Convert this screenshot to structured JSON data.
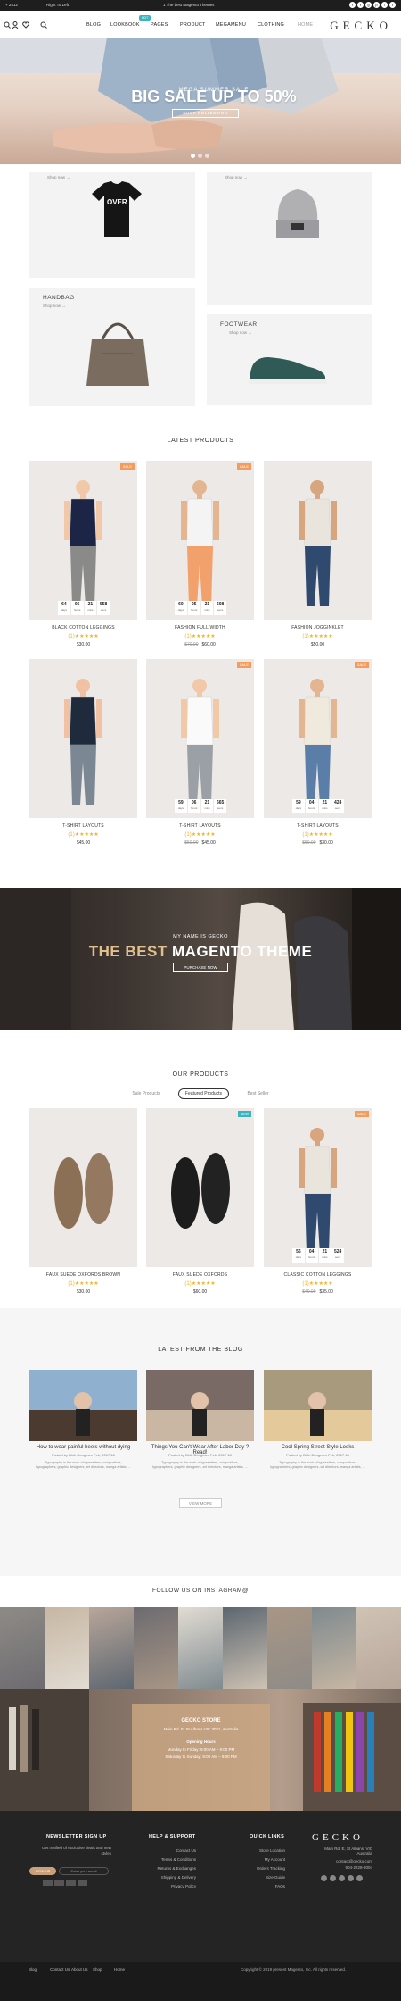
{
  "topbar": {
    "phone": "+ 2412",
    "account": "Right To Left",
    "promo": "1 The best Magento Themes",
    "social_icons": [
      "facebook-icon",
      "twitter-icon",
      "google-plus-icon",
      "pinterest-icon",
      "instagram-icon",
      "facebook-icon"
    ]
  },
  "header": {
    "logo": "GECKO",
    "nav": [
      "BLOG",
      "LOOKBOOK",
      "PAGES",
      "PRODUCT",
      "MEGAMENU",
      "CLOTHING",
      "HOME"
    ],
    "hot_badge": "HOT",
    "nav_icons": [
      "search-icon",
      "user-icon",
      "heart-icon",
      "cart-icon"
    ],
    "cart_count": "0"
  },
  "hero": {
    "subtitle": "MEGA SUMMER SALE",
    "title": "BIG SALE UP TO 50%",
    "button": "SHOP COLLECTION"
  },
  "categories": {
    "tshirt_shop": "Shop now →",
    "hat_shop": "Shop now →",
    "handbag_label": "HANDBAG",
    "handbag_shop": "Shop now →",
    "footwear_label": "FOOTWEAR",
    "footwear_shop": "Shop now →"
  },
  "latest": {
    "title": "LATEST PRODUCTS",
    "products": [
      {
        "name": "BLACK COTTON LEGGINGS",
        "rating": "(1)★★★★★",
        "old": "",
        "price": "$30.00",
        "badge": "SALE",
        "cd": [
          "64",
          "05",
          "21",
          "558"
        ],
        "cd_labels": [
          "days",
          "hours",
          "mins",
          "secs"
        ]
      },
      {
        "name": "FASHION FULL WIDTH",
        "rating": "(1)★★★★★",
        "old": "$70.00",
        "price": "$60.00",
        "badge": "SALE",
        "cd": [
          "60",
          "05",
          "21",
          "608"
        ],
        "cd_labels": [
          "days",
          "hours",
          "mins",
          "secs"
        ]
      },
      {
        "name": "FASHION JOGGINKLET",
        "rating": "(1)★★★★★",
        "old": "",
        "price": "$50.00",
        "badge": "",
        "cd": [],
        "cd_labels": []
      },
      {
        "name": "T-SHIRT LAYOUTS",
        "rating": "(1)★★★★★",
        "old": "",
        "price": "$45.00",
        "badge": "",
        "cd": [],
        "cd_labels": []
      },
      {
        "name": "T-SHIRT LAYOUTS",
        "rating": "(1)★★★★★",
        "old": "$50.00",
        "price": "$45.00",
        "badge": "SALE",
        "cd": [
          "59",
          "06",
          "21",
          "665"
        ],
        "cd_labels": [
          "days",
          "hours",
          "mins",
          "secs"
        ]
      },
      {
        "name": "T-SHIRT LAYOUTS",
        "rating": "(1)★★★★★",
        "old": "$50.00",
        "price": "$30.00",
        "badge": "SALE",
        "cd": [
          "59",
          "04",
          "21",
          "424"
        ],
        "cd_labels": [
          "days",
          "hours",
          "mins",
          "secs"
        ]
      }
    ]
  },
  "banner": {
    "kicker": "MY NAME IS GECKO",
    "title_a": "THE BEST",
    "title_b": "MAGENTO THEME",
    "button": "PURCHASE NOW"
  },
  "our_products": {
    "title": "OUR PRODUCTS",
    "tabs": [
      "Sale Products",
      "Featured Products",
      "Best Seller"
    ],
    "products": [
      {
        "name": "FAUX SUEDE OXFORDS BROWN",
        "rating": "(1)★★★★★",
        "old": "",
        "price": "$30.00",
        "badge": "",
        "cd": [],
        "cd_labels": []
      },
      {
        "name": "FAUX SUEDE OXFORDS",
        "rating": "(1)★★★★★",
        "old": "",
        "price": "$60.00",
        "badge": "NEW",
        "cd": [],
        "cd_labels": []
      },
      {
        "name": "CLASSIC COTTON LEGGINGS",
        "rating": "(1)★★★★★",
        "old": "$40.00",
        "price": "$35.00",
        "badge": "SALE",
        "cd": [
          "56",
          "04",
          "21",
          "524"
        ],
        "cd_labels": [
          "days",
          "hours",
          "mins",
          "secs"
        ]
      }
    ]
  },
  "blog": {
    "title": "LATEST FROM THE BLOG",
    "button": "VIEW MORE",
    "posts": [
      {
        "title": "How to wear painful heels without dying",
        "meta": "Posted by Birth Dongruen   Feb, 2017 18",
        "excerpt": "Typography is the work of typesetters, compositors, typographers, graphic designers, art directors, manga artists, ..."
      },
      {
        "title": "Things You Can't Wear After Labor Day ? Read!",
        "meta": "Posted by Birth Dongruen   Feb, 2017 18",
        "excerpt": "Typography is the work of typesetters, compositors, typographers, graphic designers, art directors, manga artists, ..."
      },
      {
        "title": "Cool Spring Street Style Looks",
        "meta": "Posted by Birth Dongruen   Feb, 2017 18",
        "excerpt": "Typography is the work of typesetters, compositors, typographers, graphic designers, art directors, manga artists, ..."
      }
    ]
  },
  "instagram": {
    "title": "FOLLOW US ON INSTAGRAM@"
  },
  "store": {
    "title": "GECKO STORE",
    "address": "Main Rd. E, St Albans VIC 3021, Australia",
    "hours_title": "Opening Hours",
    "hours_1": "Monday to Friday: 9:00 AM – 9:00 PM",
    "hours_2": "Saturday to Sunday: 9:00 AM – 9:00 PM"
  },
  "footer": {
    "newsletter_title": "NEWSLETTER SIGN UP",
    "newsletter_text": "Get notified of exclusive deals and new styles",
    "sign_up": "SIGN UP",
    "email_placeholder": "Enter your email",
    "support_title": "HELP & SUPPORT",
    "support_links": [
      "Contact Us",
      "Terms & Conditions",
      "Returns & Exchanges",
      "Shipping & Delivery",
      "Privacy Policy"
    ],
    "quick_title": "QUICK LINKS",
    "quick_links": [
      "Store Location",
      "My Account",
      "Orders Tracking",
      "Size Guide",
      "FAQs"
    ],
    "logo": "GECKO",
    "address": "Main Rd. E, St Albans, VIC Australia",
    "email": "contact@gecko.com",
    "phone": "904-2228-8004",
    "bottom_links": [
      "Blog",
      "Contact Us",
      "About Us",
      "Shop",
      "Home"
    ],
    "copyright": "Copyright © 2019 present Magento, Inc. All rights reserved."
  }
}
